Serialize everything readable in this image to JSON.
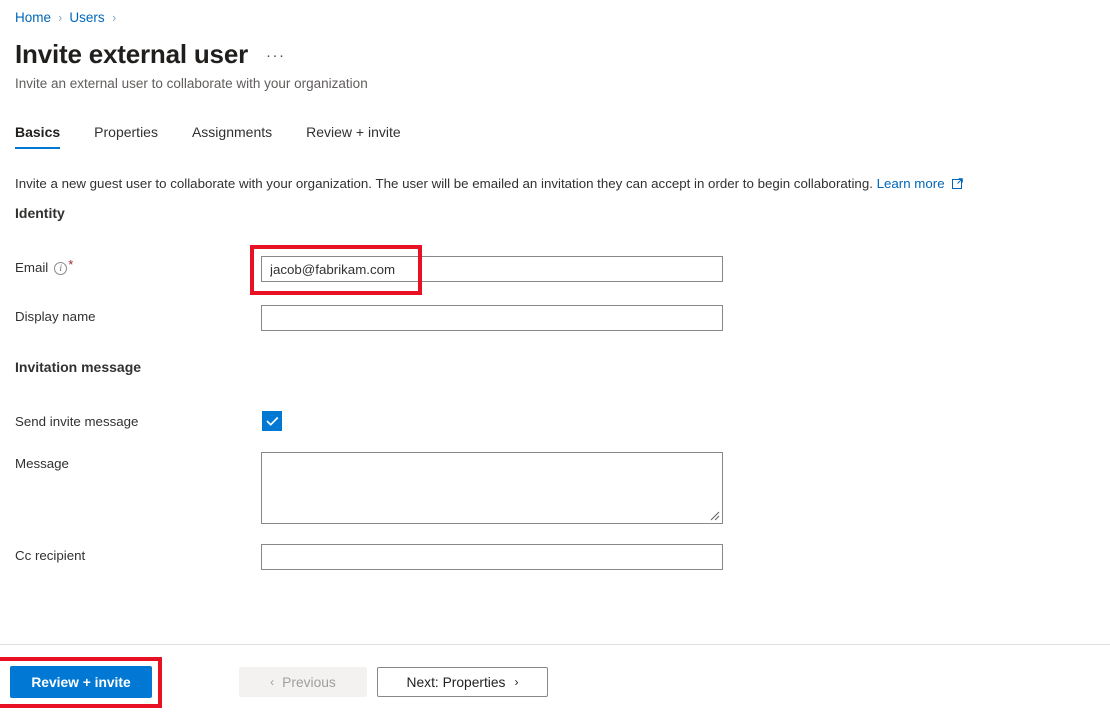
{
  "breadcrumb": {
    "items": [
      {
        "label": "Home"
      },
      {
        "label": "Users"
      }
    ],
    "separator": "›"
  },
  "header": {
    "title": "Invite external user",
    "overflow_menu": "···",
    "subtitle": "Invite an external user to collaborate with your organization"
  },
  "tabs": [
    {
      "label": "Basics",
      "active": true
    },
    {
      "label": "Properties",
      "active": false
    },
    {
      "label": "Assignments",
      "active": false
    },
    {
      "label": "Review + invite",
      "active": false
    }
  ],
  "intro": {
    "text": "Invite a new guest user to collaborate with your organization. The user will be emailed an invitation they can accept in order to begin collaborating.",
    "link_label": "Learn more",
    "link_icon": "external-link-icon"
  },
  "sections": {
    "identity": {
      "heading": "Identity",
      "email": {
        "label": "Email",
        "info_icon": "i",
        "required_mark": "*",
        "value": "jacob@fabrikam.com",
        "placeholder": ""
      },
      "display_name": {
        "label": "Display name",
        "value": "",
        "placeholder": ""
      }
    },
    "invitation_message": {
      "heading": "Invitation message",
      "send_invite": {
        "label": "Send invite message",
        "checked": true,
        "check_icon": "checkmark-icon"
      },
      "message": {
        "label": "Message",
        "value": "",
        "placeholder": ""
      },
      "cc_recipient": {
        "label": "Cc recipient",
        "value": "",
        "placeholder": ""
      }
    }
  },
  "footer": {
    "review_invite": "Review + invite",
    "previous": "Previous",
    "previous_chevron": "‹",
    "next": "Next: Properties",
    "next_chevron": "›"
  },
  "colors": {
    "accent": "#0078d4",
    "link": "#0067b8",
    "annotation": "#e81123",
    "required": "#a4262c",
    "text": "#323130",
    "muted": "#605e5c"
  }
}
